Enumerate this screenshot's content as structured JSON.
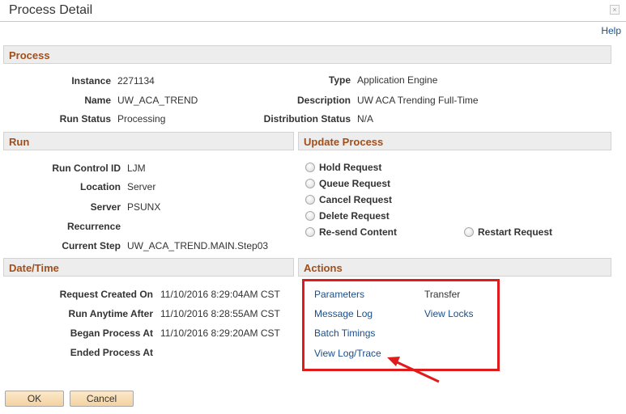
{
  "window": {
    "title": "Process Detail",
    "close_glyph": "×"
  },
  "help_label": "Help",
  "process": {
    "header": "Process",
    "instance_label": "Instance",
    "instance_value": "2271134",
    "name_label": "Name",
    "name_value": "UW_ACA_TREND",
    "run_status_label": "Run Status",
    "run_status_value": "Processing",
    "type_label": "Type",
    "type_value": "Application Engine",
    "description_label": "Description",
    "description_value": "UW ACA Trending Full-Time",
    "distribution_status_label": "Distribution Status",
    "distribution_status_value": "N/A"
  },
  "run": {
    "header": "Run",
    "run_control_id_label": "Run Control ID",
    "run_control_id_value": "LJM",
    "location_label": "Location",
    "location_value": "Server",
    "server_label": "Server",
    "server_value": "PSUNX",
    "recurrence_label": "Recurrence",
    "recurrence_value": "",
    "current_step_label": "Current Step",
    "current_step_value": "UW_ACA_TREND.MAIN.Step03"
  },
  "update_process": {
    "header": "Update Process",
    "options": [
      "Hold Request",
      "Queue Request",
      "Cancel Request",
      "Delete Request",
      "Re-send Content",
      "Restart Request"
    ]
  },
  "datetime": {
    "header": "Date/Time",
    "request_created_label": "Request Created On",
    "request_created_value": "11/10/2016  8:29:04AM CST",
    "run_anytime_label": "Run Anytime After",
    "run_anytime_value": "11/10/2016  8:28:55AM CST",
    "began_label": "Began Process At",
    "began_value": "11/10/2016  8:29:20AM CST",
    "ended_label": "Ended Process At",
    "ended_value": ""
  },
  "actions": {
    "header": "Actions",
    "parameters": "Parameters",
    "transfer": "Transfer",
    "message_log": "Message Log",
    "view_locks": "View Locks",
    "batch_timings": "Batch Timings",
    "view_log_trace": "View Log/Trace"
  },
  "buttons": {
    "ok": "OK",
    "cancel": "Cancel"
  },
  "colors": {
    "section_title": "#a24e1a",
    "link": "#1a4e8a",
    "highlight": "#e01b1b",
    "button_fill": "#f3d2a1"
  },
  "icons": {
    "close": "close-icon",
    "radio": "radio-button-icon",
    "annotation": "arrow-annotation-icon"
  }
}
